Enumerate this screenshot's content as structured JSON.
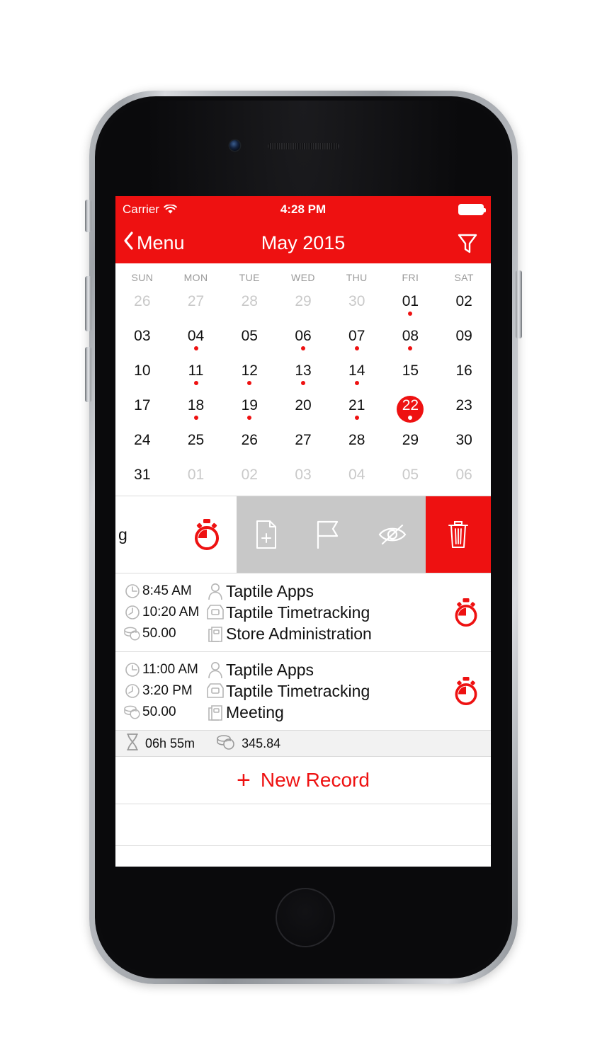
{
  "status_bar": {
    "carrier": "Carrier",
    "wifi_icon": "wifi-icon",
    "time": "4:28 PM",
    "battery_icon": "battery-full-icon"
  },
  "nav_bar": {
    "back_icon": "chevron-left-icon",
    "back_label": "Menu",
    "title": "May 2015",
    "filter_icon": "filter-funnel-icon"
  },
  "calendar": {
    "weekdays": [
      "SUN",
      "MON",
      "TUE",
      "WED",
      "THU",
      "FRI",
      "SAT"
    ],
    "selected_day": "22",
    "days": [
      {
        "label": "26",
        "muted": true,
        "dot": false
      },
      {
        "label": "27",
        "muted": true,
        "dot": false
      },
      {
        "label": "28",
        "muted": true,
        "dot": false
      },
      {
        "label": "29",
        "muted": true,
        "dot": false
      },
      {
        "label": "30",
        "muted": true,
        "dot": false
      },
      {
        "label": "01",
        "muted": false,
        "dot": true
      },
      {
        "label": "02",
        "muted": false,
        "dot": false
      },
      {
        "label": "03",
        "muted": false,
        "dot": false
      },
      {
        "label": "04",
        "muted": false,
        "dot": true
      },
      {
        "label": "05",
        "muted": false,
        "dot": false
      },
      {
        "label": "06",
        "muted": false,
        "dot": true
      },
      {
        "label": "07",
        "muted": false,
        "dot": true
      },
      {
        "label": "08",
        "muted": false,
        "dot": true
      },
      {
        "label": "09",
        "muted": false,
        "dot": false
      },
      {
        "label": "10",
        "muted": false,
        "dot": false
      },
      {
        "label": "11",
        "muted": false,
        "dot": true
      },
      {
        "label": "12",
        "muted": false,
        "dot": true
      },
      {
        "label": "13",
        "muted": false,
        "dot": true
      },
      {
        "label": "14",
        "muted": false,
        "dot": true
      },
      {
        "label": "15",
        "muted": false,
        "dot": false
      },
      {
        "label": "16",
        "muted": false,
        "dot": false
      },
      {
        "label": "17",
        "muted": false,
        "dot": false
      },
      {
        "label": "18",
        "muted": false,
        "dot": true
      },
      {
        "label": "19",
        "muted": false,
        "dot": true
      },
      {
        "label": "20",
        "muted": false,
        "dot": false
      },
      {
        "label": "21",
        "muted": false,
        "dot": true
      },
      {
        "label": "22",
        "muted": false,
        "dot": true,
        "selected": true
      },
      {
        "label": "23",
        "muted": false,
        "dot": false
      },
      {
        "label": "24",
        "muted": false,
        "dot": false
      },
      {
        "label": "25",
        "muted": false,
        "dot": false
      },
      {
        "label": "26",
        "muted": false,
        "dot": false
      },
      {
        "label": "27",
        "muted": false,
        "dot": false
      },
      {
        "label": "28",
        "muted": false,
        "dot": false
      },
      {
        "label": "29",
        "muted": false,
        "dot": false
      },
      {
        "label": "30",
        "muted": false,
        "dot": false
      },
      {
        "label": "31",
        "muted": false,
        "dot": false
      },
      {
        "label": "01",
        "muted": true,
        "dot": false
      },
      {
        "label": "02",
        "muted": true,
        "dot": false
      },
      {
        "label": "03",
        "muted": true,
        "dot": false
      },
      {
        "label": "04",
        "muted": true,
        "dot": false
      },
      {
        "label": "05",
        "muted": true,
        "dot": false
      },
      {
        "label": "06",
        "muted": true,
        "dot": false
      }
    ]
  },
  "swipe_row": {
    "partial_label": "g",
    "timer_icon": "stopwatch-icon",
    "actions": [
      {
        "icon": "document-add-icon"
      },
      {
        "icon": "flag-icon"
      },
      {
        "icon": "eye-hidden-icon"
      }
    ],
    "delete_icon": "trash-icon"
  },
  "records": [
    {
      "start_time": "8:45 AM",
      "end_time": "10:20 AM",
      "amount": "50.00",
      "client": "Taptile Apps",
      "project": "Taptile Timetracking",
      "task": "Store Administration",
      "start_icon": "clock-start-icon",
      "end_icon": "clock-end-icon",
      "amount_icon": "coins-icon",
      "client_icon": "person-icon",
      "project_icon": "tray-icon",
      "task_icon": "folder-icon",
      "timer_icon": "stopwatch-icon"
    },
    {
      "start_time": "11:00 AM",
      "end_time": "3:20 PM",
      "amount": "50.00",
      "client": "Taptile Apps",
      "project": "Taptile Timetracking",
      "task": "Meeting",
      "start_icon": "clock-start-icon",
      "end_icon": "clock-end-icon",
      "amount_icon": "coins-icon",
      "client_icon": "person-icon",
      "project_icon": "tray-icon",
      "task_icon": "folder-icon",
      "timer_icon": "stopwatch-icon"
    }
  ],
  "summary": {
    "duration_icon": "hourglass-icon",
    "duration": "06h 55m",
    "amount_icon": "coins-icon",
    "amount": "345.84"
  },
  "new_record": {
    "plus": "+",
    "label": "New Record"
  },
  "colors": {
    "accent_red": "#EE1111",
    "action_gray": "#C8C8C8",
    "summary_bg": "#F2F2F2",
    "muted_text": "#C9C9C9"
  }
}
